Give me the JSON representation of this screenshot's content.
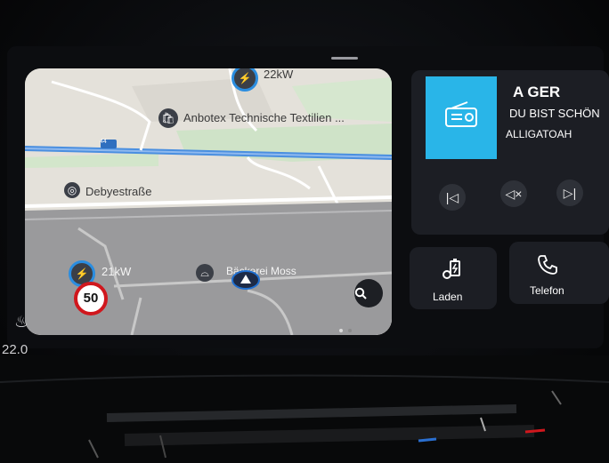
{
  "map": {
    "charge_top_label": "22kW",
    "poi_label": "Anbotex Technische Textilien ...",
    "road_number": "44",
    "street_label": "Debyestraße",
    "charge_bottom_label": "21kW",
    "place_label": "Bäckerei Moss",
    "speed_limit": "50"
  },
  "media": {
    "station": "A GER",
    "title": "DU BIST SCHÖN",
    "artist": "ALLIGATOAH",
    "prev_icon": "skip-previous-icon",
    "mute_icon": "mute-icon",
    "next_icon": "skip-next-icon"
  },
  "tiles": {
    "charging_label": "Laden",
    "phone_label": "Telefon"
  },
  "climate": {
    "temperature": "22.0"
  },
  "colors": {
    "accent": "#29b5e8",
    "nav_blue": "#1f6fd1",
    "speed_red": "#d0171d"
  }
}
